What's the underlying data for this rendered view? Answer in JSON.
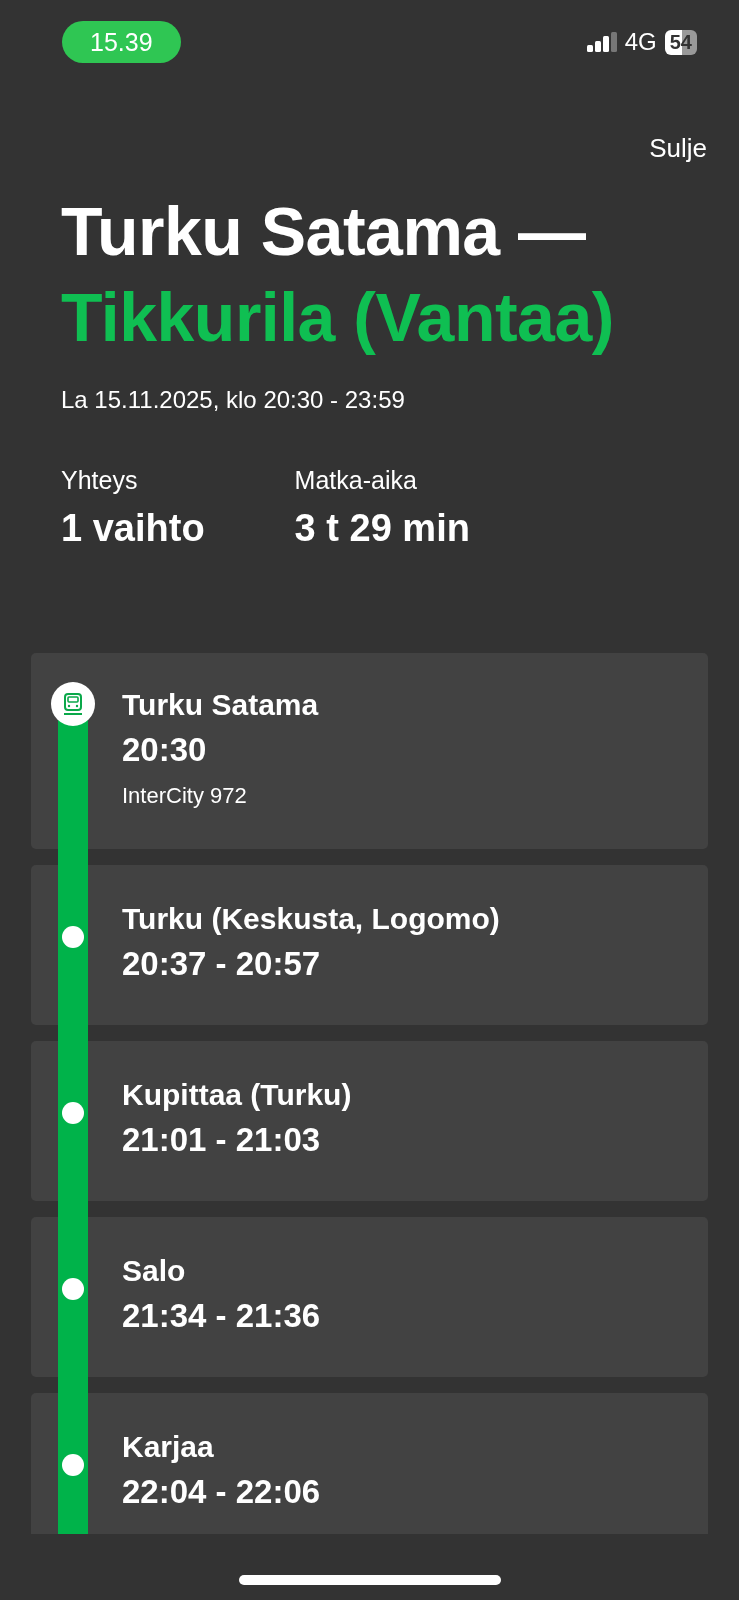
{
  "status_bar": {
    "time": "15.39",
    "network": "4G",
    "battery": "54"
  },
  "close": "Sulje",
  "title": {
    "origin": "Turku Satama —",
    "destination": "Tikkurila (Vantaa)"
  },
  "date": "La 15.11.2025, klo 20:30 - 23:59",
  "summary": [
    {
      "label": "Yhteys",
      "value": "1 vaihto"
    },
    {
      "label": "Matka-aika",
      "value": "3 t 29 min"
    }
  ],
  "stops": [
    {
      "kind": "origin",
      "name": "Turku Satama",
      "time": "20:30",
      "train": "InterCity 972"
    },
    {
      "kind": "stop",
      "name": "Turku (Keskusta, Logomo)",
      "time": "20:37 - 20:57"
    },
    {
      "kind": "stop",
      "name": "Kupittaa (Turku)",
      "time": "21:01 - 21:03"
    },
    {
      "kind": "stop",
      "name": "Salo",
      "time": "21:34 - 21:36"
    },
    {
      "kind": "stop",
      "name": "Karjaa",
      "time": "22:04 - 22:06"
    }
  ]
}
